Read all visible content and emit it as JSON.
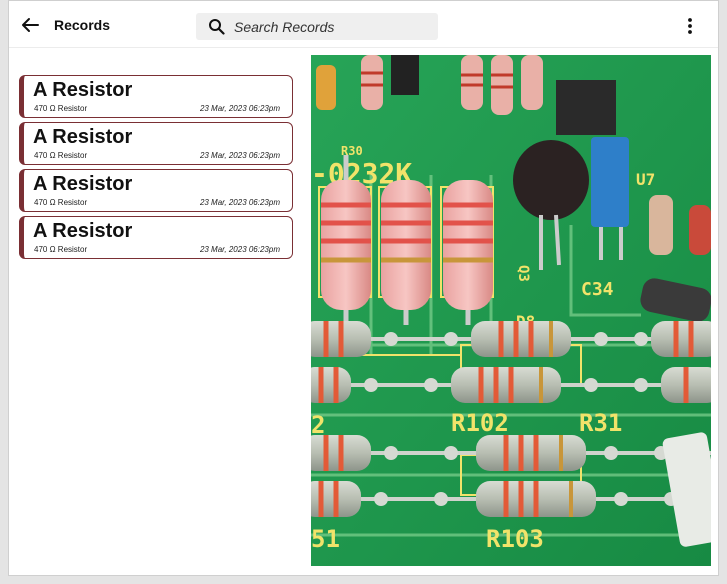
{
  "header": {
    "back_icon": "arrow-left-icon",
    "title": "Records",
    "search_placeholder": "Search Records",
    "search_value": "",
    "menu_icon": "more-vertical-icon"
  },
  "records": [
    {
      "name": "A Resistor",
      "value": "470 Ω",
      "type": "Resistor",
      "timestamp": "23 Mar, 2023 06:23pm"
    },
    {
      "name": "A Resistor",
      "value": "470 Ω",
      "type": "Resistor",
      "timestamp": "23 Mar, 2023 06:23pm"
    },
    {
      "name": "A Resistor",
      "value": "470 Ω",
      "type": "Resistor",
      "timestamp": "23 Mar, 2023 06:23pm"
    },
    {
      "name": "A Resistor",
      "value": "470 Ω",
      "type": "Resistor",
      "timestamp": "23 Mar, 2023 06:23pm"
    }
  ],
  "photo": {
    "silkscreen": [
      "-0232K",
      "R102",
      "R31",
      "R103",
      "C34",
      "Q3",
      "D8",
      "U7",
      "R30",
      "2",
      "51"
    ]
  },
  "colors": {
    "accent": "#7a2f34",
    "pcb_green": "#1f9a4e"
  }
}
